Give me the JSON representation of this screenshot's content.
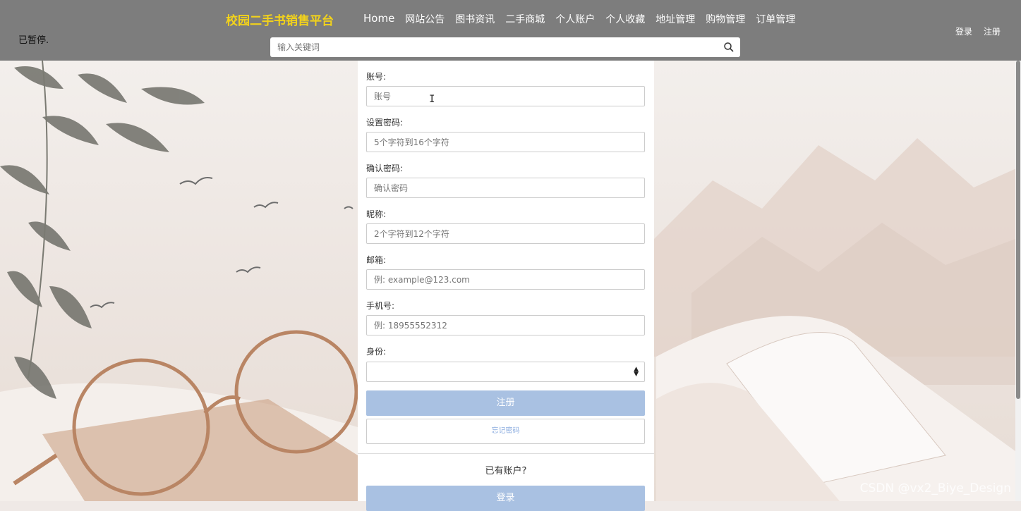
{
  "status_text": "已暂停.",
  "header": {
    "brand": "校园二手书销售平台",
    "nav": [
      "Home",
      "网站公告",
      "图书资讯",
      "二手商城",
      "个人账户",
      "个人收藏",
      "地址管理",
      "购物管理",
      "订单管理"
    ],
    "login_label": "登录",
    "register_label": "注册",
    "brand_color": "#f2d21b"
  },
  "search": {
    "placeholder": "输入关键词",
    "icon": "search-icon"
  },
  "form": {
    "account_label": "账号:",
    "account_placeholder": "账号",
    "password_label": "设置密码:",
    "password_placeholder": "5个字符到16个字符",
    "confirm_label": "确认密码:",
    "confirm_placeholder": "确认密码",
    "nickname_label": "昵称:",
    "nickname_placeholder": "2个字符到12个字符",
    "email_label": "邮箱:",
    "email_placeholder": "例: example@123.com",
    "phone_label": "手机号:",
    "phone_placeholder": "例: 18955552312",
    "identity_label": "身份:",
    "identity_value": "",
    "register_button": "注册",
    "forgot_button": "忘记密码",
    "has_account": "已有账户?",
    "login_button": "登录",
    "button_color": "#a9c1e2"
  },
  "watermark": "CSDN @vx2_Biye_Design"
}
